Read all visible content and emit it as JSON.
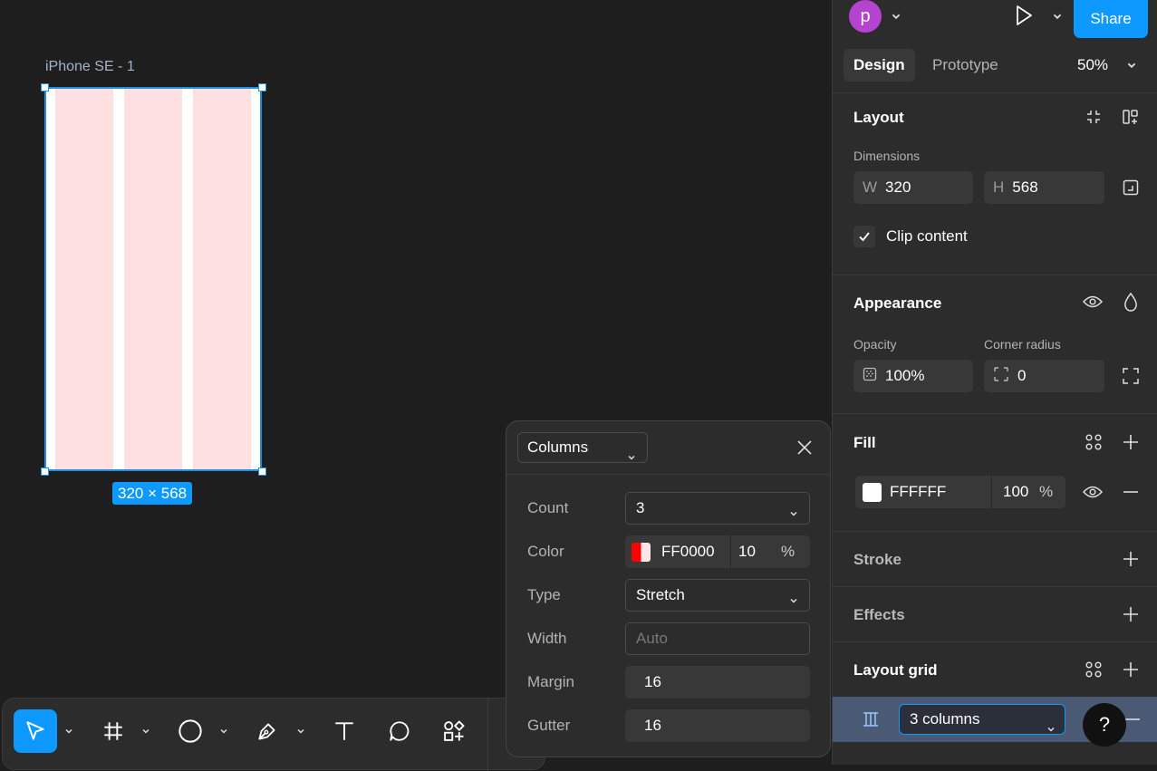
{
  "canvas": {
    "frame_label": "iPhone SE - 1",
    "size_badge": "320 × 568",
    "frame_color": "#FFFFFF",
    "grid_color": "#FF0000",
    "selection_color": "#1e90e9"
  },
  "toolbar": {
    "tools": [
      "move-tool",
      "frame-tool",
      "shape-tool",
      "pen-tool",
      "text-tool",
      "comment-tool",
      "actions-tool"
    ],
    "active_tool": "move-tool"
  },
  "header": {
    "avatar_initial": "p",
    "share_label": "Share",
    "tabs": [
      {
        "label": "Design",
        "active": true
      },
      {
        "label": "Prototype",
        "active": false
      }
    ],
    "zoom": "50%"
  },
  "layout": {
    "title": "Layout",
    "dimensions_label": "Dimensions",
    "width_prefix": "W",
    "width_value": "320",
    "height_prefix": "H",
    "height_value": "568",
    "clip_content_label": "Clip content",
    "clip_content_checked": true
  },
  "appearance": {
    "title": "Appearance",
    "opacity_label": "Opacity",
    "opacity_value": "100%",
    "corner_radius_label": "Corner radius",
    "corner_radius_value": "0"
  },
  "fill": {
    "title": "Fill",
    "hex": "FFFFFF",
    "opacity": "100",
    "percent": "%"
  },
  "stroke": {
    "title": "Stroke"
  },
  "effects": {
    "title": "Effects"
  },
  "layout_grid": {
    "title": "Layout grid",
    "selected": "3 columns"
  },
  "help_label": "?",
  "grid_popover": {
    "type_select": "Columns",
    "rows": [
      {
        "label": "Count",
        "value": "3"
      },
      {
        "label": "Color",
        "hex": "FF0000",
        "opacity": "10",
        "percent": "%"
      },
      {
        "label": "Type",
        "value": "Stretch"
      },
      {
        "label": "Width",
        "placeholder": "Auto"
      },
      {
        "label": "Margin",
        "value": "16"
      },
      {
        "label": "Gutter",
        "value": "16"
      }
    ]
  }
}
